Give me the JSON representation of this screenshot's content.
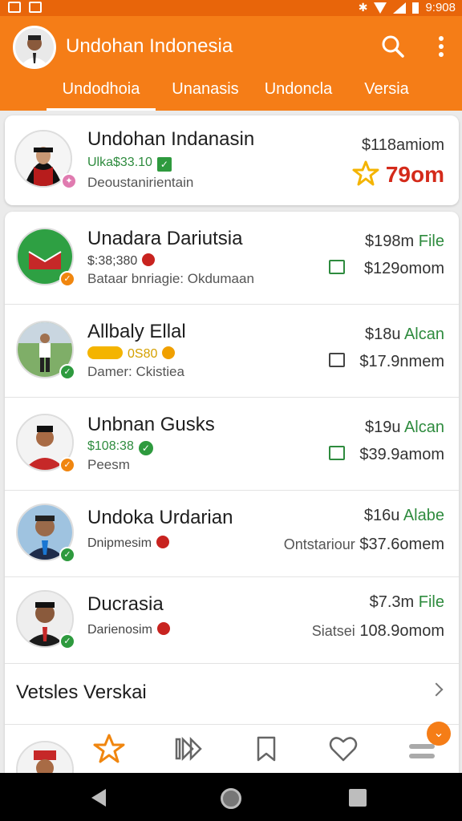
{
  "status_bar": {
    "time": "9:908"
  },
  "app_bar": {
    "title": "Undohan Indonesia",
    "search_icon": "search-icon",
    "more_icon": "more-vert-icon",
    "tabs": [
      "Undodhoia",
      "Unanasis",
      "Undoncla",
      "Versia"
    ],
    "active_tab": 0
  },
  "featured": {
    "name": "Undohan Indanasin",
    "sub1": "Ulka$33.10",
    "sub2": "Deoustanirientain",
    "right1": "$118amiom",
    "right2": "79om"
  },
  "rows": [
    {
      "name": "Unadara Dariutsia",
      "sub1": "$:38;380",
      "sub2": "Bataar bnriagie: Okdumaan",
      "right1a": "$198m",
      "right1b": "File",
      "right2": "$129omom"
    },
    {
      "name": "Allbaly Ellal",
      "sub1": "0S80",
      "sub2": "Damer: Ckistiea",
      "right1a": "$18u",
      "right1b": "Alcan",
      "right2": "$17.9nmem"
    },
    {
      "name": "Unbnan Gusks",
      "sub1": "$108:38",
      "sub2": "Peesm",
      "right1a": "$19u",
      "right1b": "Alcan",
      "right2": "$39.9amom"
    },
    {
      "name": "Undoka Urdarian",
      "sub1": "Dnipmesim",
      "right1a": "$16u",
      "right1b": "Alabe",
      "right2_label": "Ontstariour",
      "right2": "$37.6omem"
    },
    {
      "name": "Ducrasia",
      "sub1": "Darienosim",
      "right1a": "$7.3m",
      "right1b": "File",
      "right2_label": "Siatsei",
      "right2": "108.9omom"
    }
  ],
  "more_link": {
    "label": "Vetsles Verskai"
  },
  "bottom_nav": [
    "star-icon",
    "fast-forward-icon",
    "bookmark-icon",
    "heart-icon",
    "menu-icon"
  ],
  "colors": {
    "primary": "#f57d17",
    "accent_green": "#2e8b3e",
    "featured_red": "#d42a1a",
    "star_yellow": "#f4b400"
  }
}
